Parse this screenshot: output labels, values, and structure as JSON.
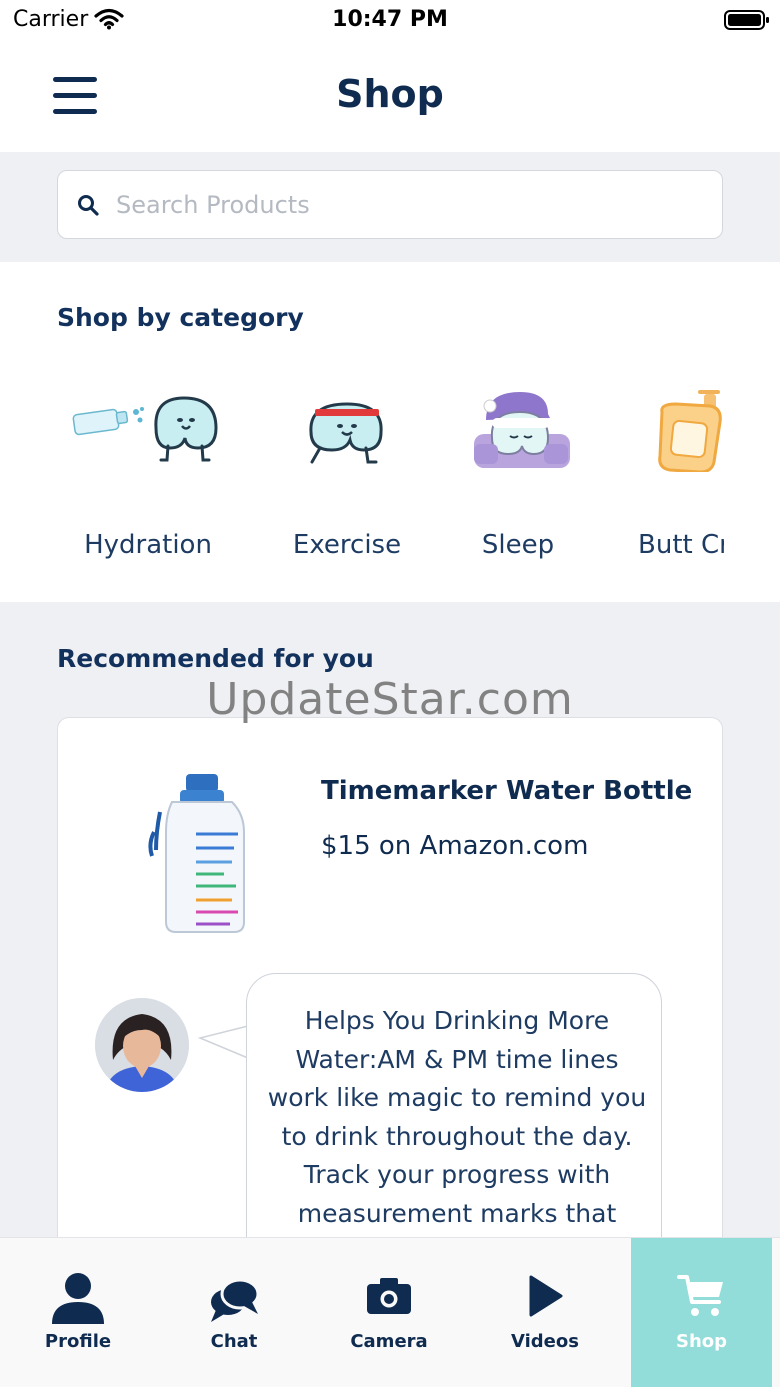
{
  "status_bar": {
    "carrier": "Carrier",
    "time": "10:47 PM"
  },
  "header": {
    "title": "Shop"
  },
  "search": {
    "placeholder": "Search Products",
    "value": ""
  },
  "categories": {
    "heading": "Shop by category",
    "items": [
      {
        "label": "Hydration"
      },
      {
        "label": "Exercise"
      },
      {
        "label": "Sleep"
      },
      {
        "label": "Butt Cr"
      }
    ]
  },
  "recommended": {
    "heading": "Recommended for you",
    "watermark": "UpdateStar.com",
    "product": {
      "name": "Timemarker Water Bottle",
      "price": "$15 on Amazon.com",
      "description": "Helps You Drinking More Water:AM & PM time lines work like magic to remind you to drink throughout the day. Track your progress with measurement marks that"
    }
  },
  "tabs": [
    {
      "label": "Profile",
      "icon": "person-icon"
    },
    {
      "label": "Chat",
      "icon": "chat-bubbles-icon"
    },
    {
      "label": "Camera",
      "icon": "camera-icon"
    },
    {
      "label": "Videos",
      "icon": "play-icon"
    },
    {
      "label": "Shop",
      "icon": "cart-icon",
      "active": true
    }
  ],
  "colors": {
    "primary": "#0f2b4f",
    "accent": "#92dcd9",
    "background": "#eff0f3"
  }
}
